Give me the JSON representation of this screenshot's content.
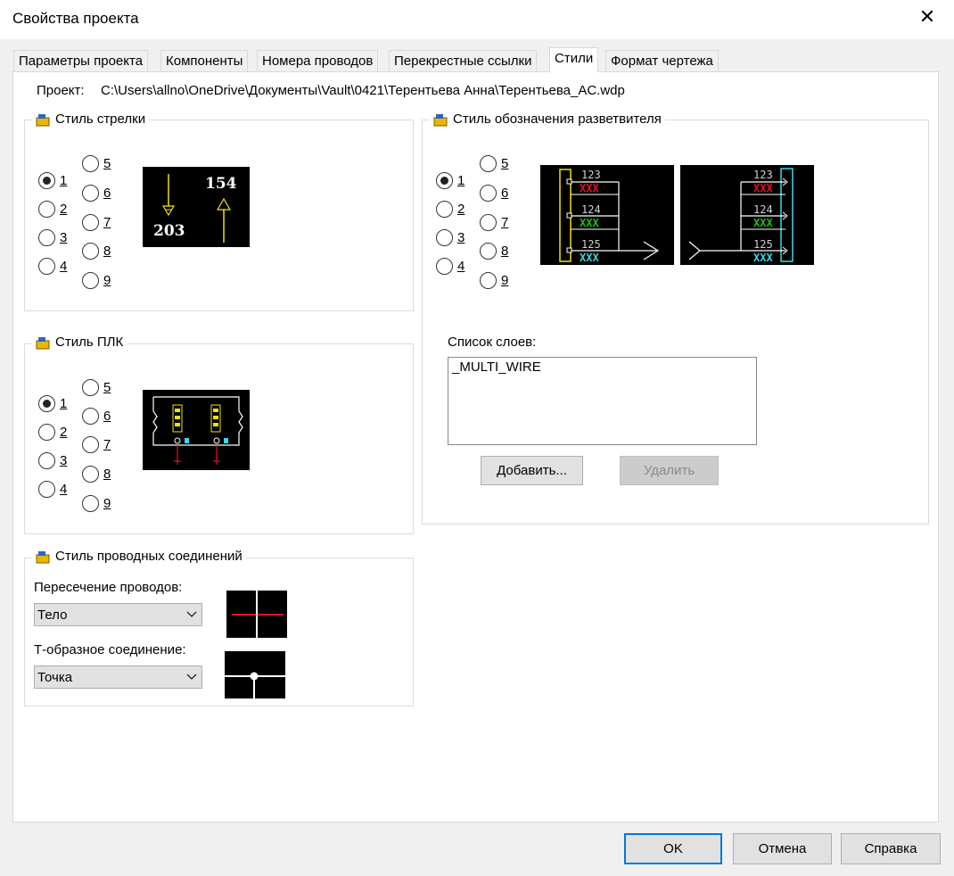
{
  "window": {
    "title": "Свойства проекта"
  },
  "tabs": [
    {
      "label": "Параметры проекта"
    },
    {
      "label": "Компоненты"
    },
    {
      "label": "Номера проводов"
    },
    {
      "label": "Перекрестные ссылки"
    },
    {
      "label": "Стили",
      "active": true
    },
    {
      "label": "Формат чертежа"
    }
  ],
  "project": {
    "label": "Проект:",
    "path": "C:\\Users\\allno\\OneDrive\\Документы\\Vault\\0421\\Терентьева Анна\\Терентьева_AC.wdp"
  },
  "arrow_style": {
    "title": "Стиль стрелки",
    "options": [
      "1",
      "2",
      "3",
      "4",
      "5",
      "6",
      "7",
      "8",
      "9"
    ],
    "selected": "1",
    "preview": {
      "top_number": "154",
      "bottom_number": "203"
    }
  },
  "plc_style": {
    "title": "Стиль ПЛК",
    "options": [
      "1",
      "2",
      "3",
      "4",
      "5",
      "6",
      "7",
      "8",
      "9"
    ],
    "selected": "1"
  },
  "fanin_style": {
    "title": "Стиль обозначения разветвителя",
    "options": [
      "1",
      "2",
      "3",
      "4",
      "5",
      "6",
      "7",
      "8",
      "9"
    ],
    "selected": "1",
    "preview": {
      "wires": [
        "123",
        "124",
        "125"
      ],
      "tag": "XXX"
    },
    "layers_label": "Список слоев:",
    "layers": [
      "_MULTI_WIRE"
    ],
    "add_button": "Добавить...",
    "delete_button": "Удалить"
  },
  "wire_style": {
    "title": "Стиль проводных соединений",
    "crossing_label": "Пересечение проводов:",
    "crossing_value": "Тело",
    "tee_label": "Т-образное соединение:",
    "tee_value": "Точка"
  },
  "footer": {
    "ok": "OK",
    "cancel": "Отмена",
    "help": "Справка"
  },
  "colors": {
    "accent": "#0078d7",
    "wire_red": "#e81123",
    "wire_green": "#16c60c",
    "wire_cyan": "#3ad8e8",
    "yellow": "#f2e300"
  }
}
